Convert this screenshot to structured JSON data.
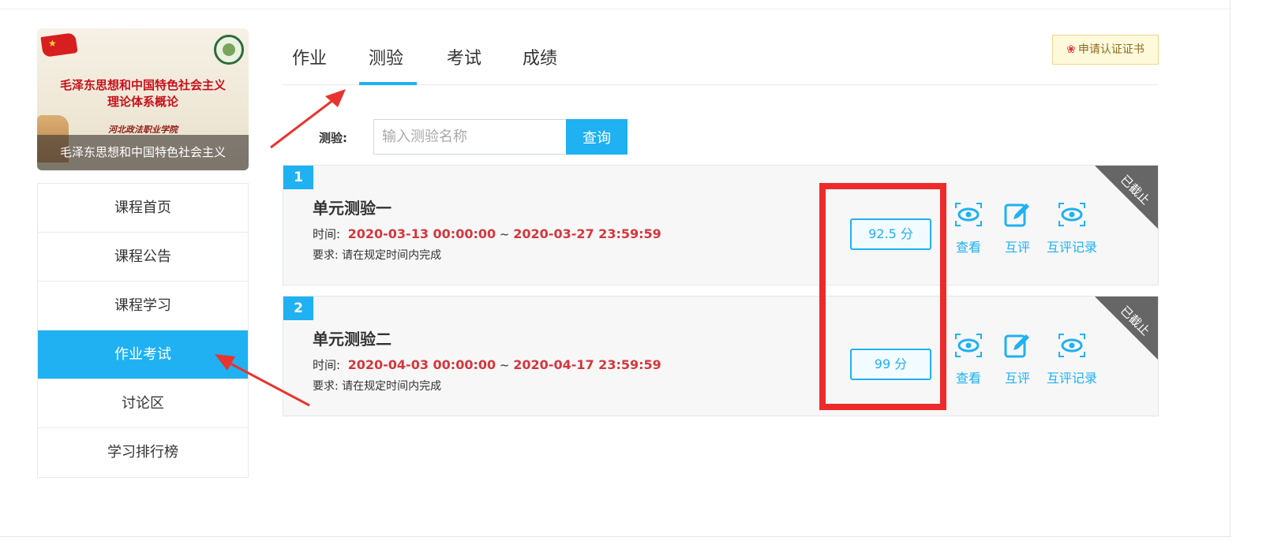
{
  "course": {
    "cover_title_line1": "毛泽东思想和中国特色社会主义",
    "cover_title_line2": "理论体系概论",
    "cover_school": "河北政法职业学院",
    "caption": "毛泽东思想和中国特色社会主义"
  },
  "menu": {
    "items": [
      {
        "label": "课程首页"
      },
      {
        "label": "课程公告"
      },
      {
        "label": "课程学习"
      },
      {
        "label": "作业考试"
      },
      {
        "label": "讨论区"
      },
      {
        "label": "学习排行榜"
      }
    ],
    "active_index": 3
  },
  "tabs": [
    "作业",
    "测验",
    "考试",
    "成绩"
  ],
  "active_tab": "测验",
  "certificate_button": "申请认证证书",
  "search": {
    "label": "测验:",
    "placeholder": "输入测验名称",
    "button": "查询"
  },
  "quizzes": [
    {
      "number": "1",
      "title": "单元测验一",
      "time_label": "时间:",
      "time_start": "2020-03-13 00:00:00",
      "time_sep": "~",
      "time_end": "2020-03-27 23:59:59",
      "requirement": "要求: 请在规定时间内完成",
      "score": "92.5 分",
      "status": "已截止",
      "actions": [
        "查看",
        "互评",
        "互评记录"
      ]
    },
    {
      "number": "2",
      "title": "单元测验二",
      "time_label": "时间:",
      "time_start": "2020-04-03 00:00:00",
      "time_sep": "~",
      "time_end": "2020-04-17 23:59:59",
      "requirement": "要求: 请在规定时间内完成",
      "score": "99 分",
      "status": "已截止",
      "actions": [
        "查看",
        "互评",
        "互评记录"
      ]
    }
  ],
  "colors": {
    "accent": "#1fb1f2",
    "time_red": "#d4373d",
    "annotation_red": "#ee2b2b",
    "status_corner": "#666666"
  }
}
